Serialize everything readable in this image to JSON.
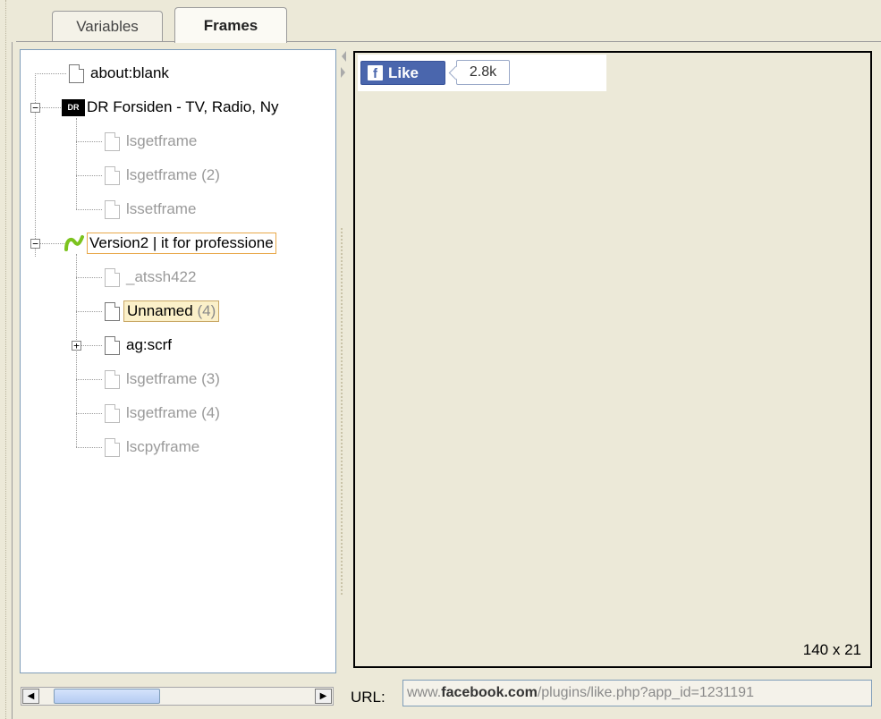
{
  "tabs": [
    "Variables",
    "Frames"
  ],
  "active_tab": "Frames",
  "tree": [
    {
      "label": "about:blank",
      "dim": false
    },
    {
      "label": "DR Forsiden - TV, Radio, Ny",
      "dim": false
    },
    {
      "label": "lsgetframe",
      "dim": true
    },
    {
      "label": "lsgetframe (2)",
      "dim": true
    },
    {
      "label": "lssetframe",
      "dim": true
    },
    {
      "label": "Version2 | it for professione",
      "dim": false
    },
    {
      "label": "_atssh422",
      "dim": true
    },
    {
      "label": "Unnamed",
      "suffix": "(4)",
      "dim": false
    },
    {
      "label": "ag:scrf",
      "dim": false
    },
    {
      "label": "lsgetframe (3)",
      "dim": true
    },
    {
      "label": "lsgetframe (4)",
      "dim": true
    },
    {
      "label": "lscpyframe",
      "dim": true
    }
  ],
  "icons": {
    "dr": "DR",
    "version2": "version2-logo"
  },
  "preview": {
    "like_label": "Like",
    "like_count": "2.8k",
    "dimensions": "140 x 21"
  },
  "url": {
    "label": "URL:",
    "prefix": "www.",
    "domain": "facebook.com",
    "path": "/plugins/like.php?app_id=1231191"
  },
  "colors": {
    "background": "#ece9d8",
    "facebook_blue": "#4a66ad",
    "selection": "#fbf0c9"
  }
}
